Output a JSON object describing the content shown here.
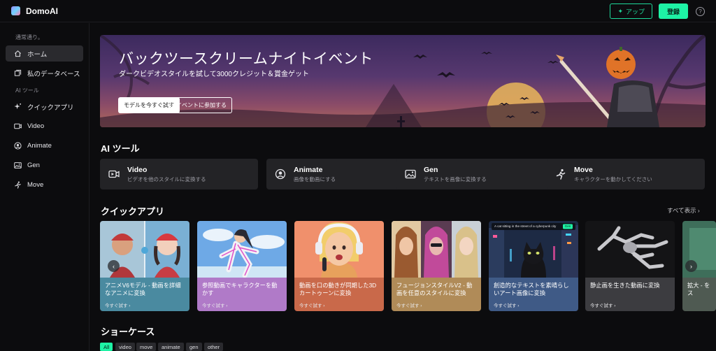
{
  "app": {
    "name": "DomoAI"
  },
  "header": {
    "app_button": "アップ",
    "register_button": "登録",
    "help": "?"
  },
  "sidebar": {
    "section_general": "通常通り。",
    "items_top": [
      {
        "label": "ホーム",
        "icon": "home-icon",
        "active": true
      },
      {
        "label": "私のデータベース",
        "icon": "database-icon",
        "active": false
      }
    ],
    "section_tools": "AI ツール",
    "items_tools": [
      {
        "label": "クイックアプリ",
        "icon": "sparkle-icon"
      },
      {
        "label": "Video",
        "icon": "video-icon"
      },
      {
        "label": "Animate",
        "icon": "animate-icon"
      },
      {
        "label": "Gen",
        "icon": "image-icon"
      },
      {
        "label": "Move",
        "icon": "running-icon"
      }
    ]
  },
  "banner": {
    "title": "バックツースクリームナイトイベント",
    "subtitle": "ダークビデオスタイルを試して3000クレジット＆賞金ゲット",
    "primary_button": "モデルを今すぐ試す",
    "secondary_button": "イベントに参加する"
  },
  "ai_tools": {
    "heading": "AI ツール",
    "cards": [
      {
        "title": "Video",
        "desc": "ビデオを他のスタイルに変換する",
        "icon": "video-icon"
      },
      {
        "title": "Animate",
        "desc": "画像を動画にする",
        "icon": "animate-icon"
      },
      {
        "title": "Gen",
        "desc": "テキストを画像に変換する",
        "icon": "image-icon"
      },
      {
        "title": "Move",
        "desc": "キャラクターを動かしてください",
        "icon": "running-icon"
      }
    ]
  },
  "quick_apps": {
    "heading": "クイックアプリ",
    "see_all": "すべて表示 ›",
    "try_label": "今すぐ試す ›",
    "cards": [
      {
        "title": "アニメV6モデル - 動画を詳細なアニメに変換",
        "color": "#4a8aa0"
      },
      {
        "title": "参照動画でキャラクターを動かす",
        "color": "#b07ac8"
      },
      {
        "title": "動画を口の動きが同期した3Dカートゥーンに変換",
        "color": "#c9694a"
      },
      {
        "title": "フュージョンスタイルV2 - 動画を任意のスタイルに変換",
        "color": "#b08b58"
      },
      {
        "title": "創造的なテキストを素晴らしいアート画像に変換",
        "color": "#3f5a86",
        "prompt": "A cat sitting in the street of a cyberpunk city",
        "prompt_badge": "Gen"
      },
      {
        "title": "静止画を生きた動画に変換",
        "color": "#3c3c40"
      },
      {
        "title": "拡大 - をス",
        "color": "#4f5a52"
      }
    ]
  },
  "showcase": {
    "heading": "ショーケース",
    "tags": [
      {
        "label": "All",
        "active": true
      },
      {
        "label": "video",
        "active": false
      },
      {
        "label": "move",
        "active": false
      },
      {
        "label": "animate",
        "active": false
      },
      {
        "label": "gen",
        "active": false
      },
      {
        "label": "other",
        "active": false
      }
    ]
  }
}
